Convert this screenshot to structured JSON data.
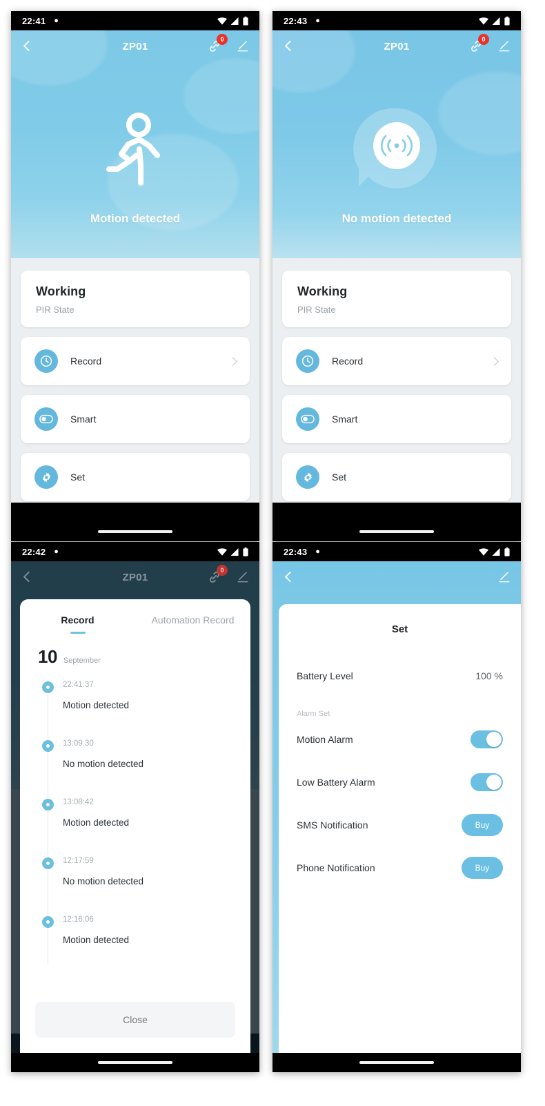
{
  "device": {
    "name": "ZP01"
  },
  "icons": {
    "wifi": "wifi-icon",
    "signal": "signal-icon",
    "battery": "battery-icon",
    "bell": "bell-icon",
    "back": "back-chevron-icon",
    "link": "link-icon",
    "edit": "edit-pen-icon",
    "clock": "clock-icon",
    "toggle": "toggle-icon",
    "gear": "gear-icon",
    "running": "running-person-icon",
    "radar": "radar-signal-icon"
  },
  "colors": {
    "accent": "#6bbfe2",
    "sky_top": "#7cc8e6",
    "sky_bottom": "#b6e1ef",
    "badge_red": "#e8322a",
    "page_bg": "#eceff1"
  },
  "panel1": {
    "statusbar": {
      "time": "22:41",
      "bell": "▲"
    },
    "appbar": {
      "title": "ZP01",
      "badge_count": "0"
    },
    "hero": {
      "label": "Motion detected",
      "icon": "running-person-icon"
    },
    "status_card": {
      "title": "Working",
      "subtitle": "PIR State"
    },
    "rows": [
      {
        "label": "Record",
        "icon": "clock-icon",
        "chevron": true
      },
      {
        "label": "Smart",
        "icon": "toggle-icon",
        "chevron": false
      },
      {
        "label": "Set",
        "icon": "gear-icon",
        "chevron": false
      }
    ]
  },
  "panel2": {
    "statusbar": {
      "time": "22:43",
      "bell": "▲"
    },
    "appbar": {
      "title": "ZP01",
      "badge_count": "0"
    },
    "hero": {
      "label": "No motion detected",
      "icon": "radar-signal-icon"
    },
    "status_card": {
      "title": "Working",
      "subtitle": "PIR State"
    },
    "rows": [
      {
        "label": "Record",
        "icon": "clock-icon",
        "chevron": true
      },
      {
        "label": "Smart",
        "icon": "toggle-icon",
        "chevron": false
      },
      {
        "label": "Set",
        "icon": "gear-icon",
        "chevron": false
      }
    ]
  },
  "panel3": {
    "statusbar": {
      "time": "22:42",
      "bell": "▲"
    },
    "appbar": {
      "title": "ZP01",
      "badge_count": "0"
    },
    "tabs": [
      {
        "label": "Record",
        "active": true
      },
      {
        "label": "Automation Record",
        "active": false
      }
    ],
    "date": {
      "day": "10",
      "month": "September"
    },
    "entries": [
      {
        "time": "22:41:37",
        "text": "Motion detected"
      },
      {
        "time": "13:09:30",
        "text": "No motion detected"
      },
      {
        "time": "13:08:42",
        "text": "Motion detected"
      },
      {
        "time": "12:17:59",
        "text": "No motion detected"
      },
      {
        "time": "12:16:06",
        "text": "Motion detected"
      }
    ],
    "close_label": "Close"
  },
  "panel4": {
    "statusbar": {
      "time": "22:43",
      "bell": "▲"
    },
    "title": "Set",
    "battery": {
      "label": "Battery Level",
      "value": "100 %"
    },
    "group_label": "Alarm Set",
    "settings": [
      {
        "label": "Motion Alarm",
        "control": "toggle",
        "value": "on"
      },
      {
        "label": "Low Battery Alarm",
        "control": "toggle",
        "value": "on"
      },
      {
        "label": "SMS Notification",
        "control": "button",
        "value": "Buy"
      },
      {
        "label": "Phone Notification",
        "control": "button",
        "value": "Buy"
      }
    ]
  }
}
